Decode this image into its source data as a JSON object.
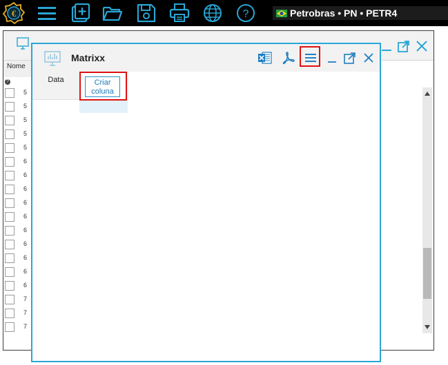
{
  "toolbar": {
    "icons": [
      "app-logo-icon",
      "menu-icon",
      "add-icon",
      "open-folder-icon",
      "save-icon",
      "print-icon",
      "globe-icon",
      "help-icon"
    ],
    "accent_color": "#29a6d6"
  },
  "asset": {
    "flag": "brazil-flag-icon",
    "label": "Petrobras • PN • PETR4"
  },
  "background_window": {
    "column_header": "Nome",
    "help_badge": "?",
    "rows": [
      "5",
      "5",
      "5",
      "5",
      "5",
      "6",
      "6",
      "6",
      "6",
      "6",
      "6",
      "6",
      "6",
      "6",
      "6",
      "7",
      "7",
      "7"
    ]
  },
  "matrixx": {
    "title": "Matrixx",
    "header_buttons": [
      "excel-icon",
      "pdf-icon",
      "menu-icon",
      "minimize-icon",
      "popout-icon",
      "close-icon"
    ],
    "columns": [
      "Data"
    ],
    "add_column_label": "Criar coluna"
  },
  "colors": {
    "window_border": "#29a6d6",
    "highlight": "#e01010",
    "toolbar_bg": "#000000"
  }
}
